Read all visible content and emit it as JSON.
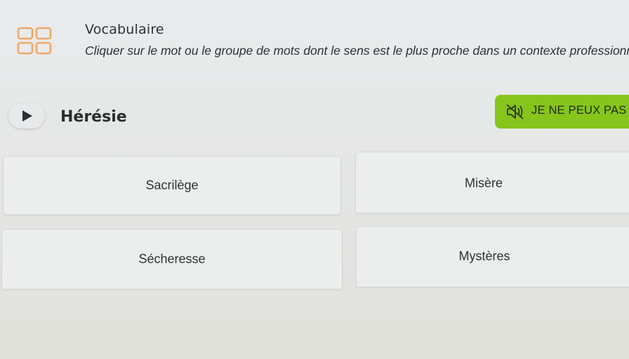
{
  "header": {
    "icon": "grid-icon",
    "title": "Vocabulaire",
    "instructions": "Cliquer sur le mot ou le groupe de mots dont le sens est le plus proche dans un contexte professionnel."
  },
  "question": {
    "play_icon": "play-icon",
    "word": "Hérésie"
  },
  "audio_fallback": {
    "icon": "mute-speaker-icon",
    "label": "JE NE PEUX PAS É",
    "color": "#86c51c"
  },
  "options": [
    {
      "label": "Sacrilège"
    },
    {
      "label": "Misère"
    },
    {
      "label": "Sécheresse"
    },
    {
      "label": "Mystères"
    }
  ]
}
